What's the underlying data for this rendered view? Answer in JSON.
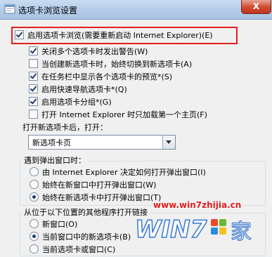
{
  "window": {
    "title": "选项卡浏览设置",
    "close_label": "X"
  },
  "main_option": {
    "label": "启用选项卡浏览(需要重新启动 Internet Explorer)(E)",
    "checked": true
  },
  "sub_options": [
    {
      "label": "关闭多个选项卡时发出警告(W)",
      "checked": true
    },
    {
      "label": "当创建新选项卡时，始终切换到新选项卡(A)",
      "checked": false
    },
    {
      "label": "在任务栏中显示各个选项卡的预览*(S)",
      "checked": true
    },
    {
      "label": "启用快速导航选项卡*(Q)",
      "checked": true
    },
    {
      "label": "启用选项卡分组*(G)",
      "checked": true
    },
    {
      "label": "打开 Internet Explorer 时只加载第一个主页(F)",
      "checked": false
    }
  ],
  "new_tab": {
    "label": "打开新选项卡后，打开：",
    "selected": "新选项卡页"
  },
  "popups": {
    "label": "遇到弹出窗口时：",
    "options": [
      {
        "label": "由 Internet Explorer 决定如何打开弹出窗口(I)",
        "checked": false
      },
      {
        "label": "始终在新窗口中打开弹出窗口(W)",
        "checked": false
      },
      {
        "label": "始终在新选项卡中打开弹出窗口(T)",
        "checked": true
      }
    ]
  },
  "external_links": {
    "label": "从位于以下位置的其他程序打开链接",
    "options": [
      {
        "label": "新窗口(O)",
        "checked": false
      },
      {
        "label": "当前窗口中的新选项卡(B)",
        "checked": true
      },
      {
        "label": "当前选项卡或窗口(C)",
        "checked": false
      }
    ]
  },
  "watermark": {
    "url": "www.win7zhijia.cn",
    "logo_text": "WIN7",
    "logo_suffix": "家"
  },
  "colors": {
    "highlight": "#e0201c",
    "title_bar": "#b4cce8"
  }
}
